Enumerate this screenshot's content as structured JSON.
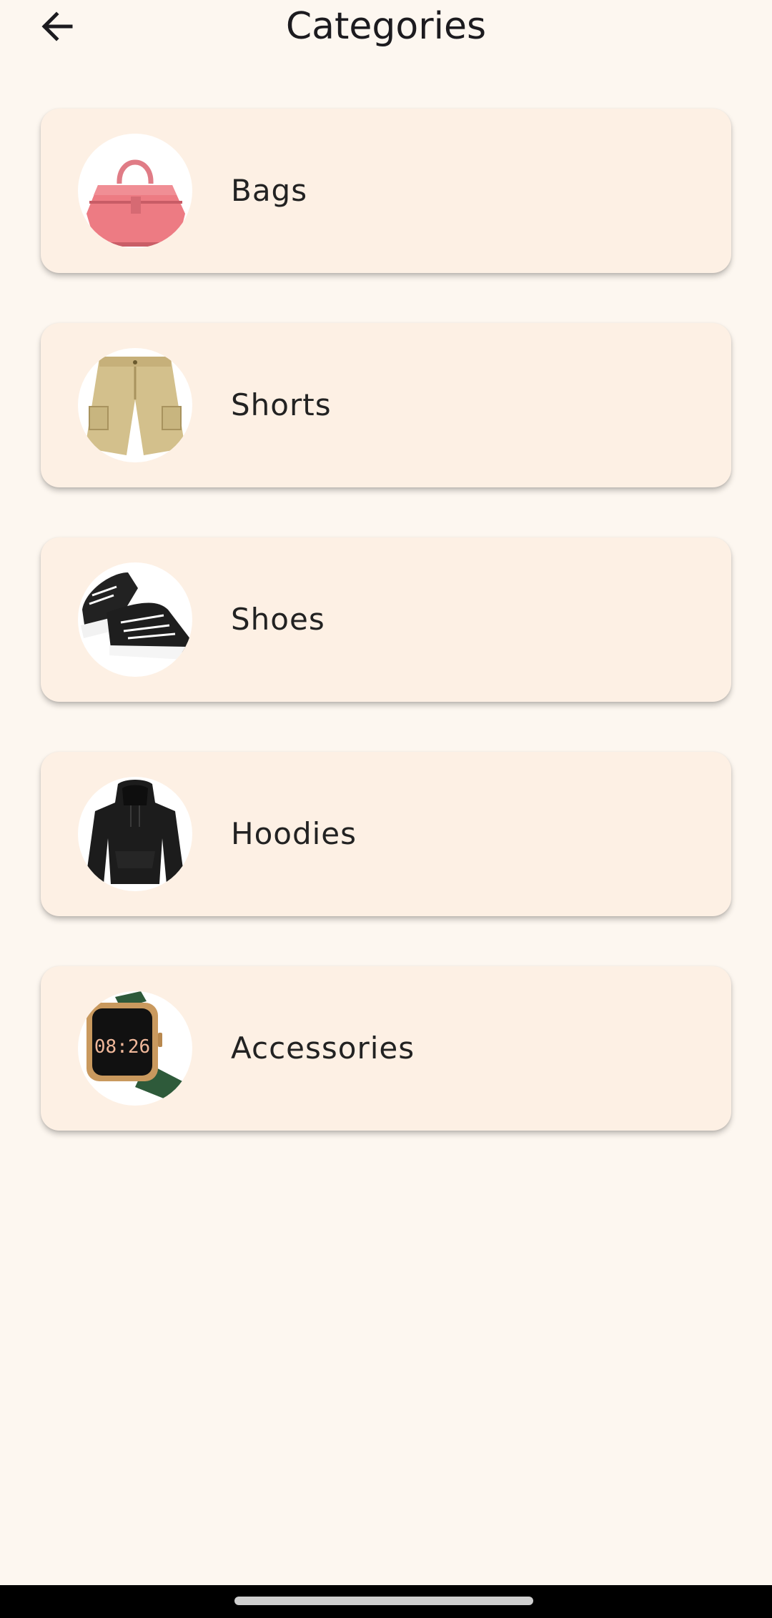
{
  "header": {
    "title": "Categories",
    "back_icon": "arrow-left-icon"
  },
  "categories": [
    {
      "label": "Bags",
      "icon": "handbag-image"
    },
    {
      "label": "Shorts",
      "icon": "shorts-image"
    },
    {
      "label": "Shoes",
      "icon": "sneakers-image"
    },
    {
      "label": "Hoodies",
      "icon": "hoodie-image"
    },
    {
      "label": "Accessories",
      "icon": "smartwatch-image",
      "watch_time": "08:26"
    }
  ],
  "colors": {
    "background": "#fdf7f0",
    "card": "#fdf0e4",
    "text": "#1c1b1f"
  }
}
